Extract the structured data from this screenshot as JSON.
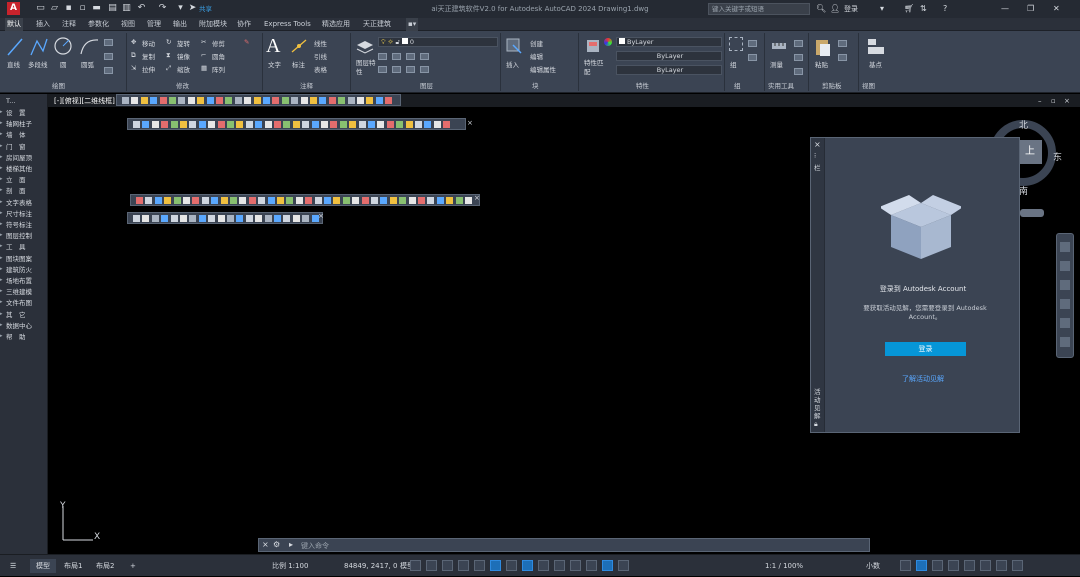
{
  "title": {
    "logo": "A",
    "text": "ai天正建筑软件V2.0 for Autodesk AutoCAD 2024   Drawing1.dwg",
    "share": "共享",
    "search_placeholder": "键入关键字或短语",
    "user": "登录"
  },
  "menus": [
    "默认",
    "插入",
    "注释",
    "参数化",
    "视图",
    "管理",
    "输出",
    "附加模块",
    "协作",
    "Express Tools",
    "精选应用",
    "天正建筑"
  ],
  "ribbon": {
    "draw": {
      "line": "直线",
      "polyline": "多段线",
      "circle": "圆",
      "arc": "圆弧",
      "label": "绘图"
    },
    "modify": {
      "move": "移动",
      "rotate": "旋转",
      "trim": "修剪",
      "copy": "复制",
      "mirror": "镜像",
      "fillet": "圆角",
      "stretch": "拉伸",
      "scale": "缩放",
      "array": "阵列",
      "label": "修改"
    },
    "annotation": {
      "text": "文字",
      "dim": "标注",
      "linear": "线性",
      "leader": "引线",
      "table": "表格",
      "label": "注释"
    },
    "layers": {
      "props": "图层特性",
      "layer_value": "0",
      "label": "图层"
    },
    "block": {
      "insert": "插入",
      "create": "创建",
      "edit": "编辑",
      "edit_attr": "编辑属性",
      "label": "块"
    },
    "properties": {
      "match": "特性匹配",
      "color": "ByLayer",
      "linetype": "ByLayer",
      "lineweight": "ByLayer",
      "label": "特性"
    },
    "groups": {
      "group": "组",
      "label": "组"
    },
    "utilities": {
      "measure": "测量",
      "label": "实用工具"
    },
    "clipboard": {
      "paste": "粘贴",
      "label": "剪贴板"
    },
    "view": {
      "base": "基点",
      "label": "视图"
    }
  },
  "drawing": {
    "tab_label": "[-][俯视][二维线框]",
    "axis_x": "X",
    "axis_y": "Y",
    "compass": {
      "n": "北",
      "e": "东",
      "s": "南",
      "top": "上"
    }
  },
  "left_panel": {
    "header": "T...",
    "items": [
      "设　置",
      "轴网柱子",
      "墙　体",
      "门　窗",
      "房间屋顶",
      "楼梯其他",
      "立　面",
      "剖　面",
      "文字表格",
      "尺寸标注",
      "符号标注",
      "图层控制",
      "工　具",
      "图块图案",
      "建筑防火",
      "场地布置",
      "三维建模",
      "文件布图",
      "其　它",
      "数据中心",
      "帮　助"
    ]
  },
  "panel": {
    "title": "登录到 Autodesk Account",
    "body": "要获取活动见解，您需要登录到 Autodesk Account。",
    "button": "登录",
    "link": "了解活动见解",
    "side_label": "活动见解",
    "top_label": "栏"
  },
  "command": {
    "placeholder": "键入命令"
  },
  "status": {
    "tabs": [
      "模型",
      "布局1",
      "布局2"
    ],
    "scale": "比例 1:100",
    "coords": "84849, 2417, 0",
    "model": "模型",
    "zoom": "1:1 / 100%",
    "units": "小数"
  },
  "colors": {
    "accent": "#0696d7",
    "ribbon": "#3b4453",
    "chrome": "#2b303a"
  }
}
